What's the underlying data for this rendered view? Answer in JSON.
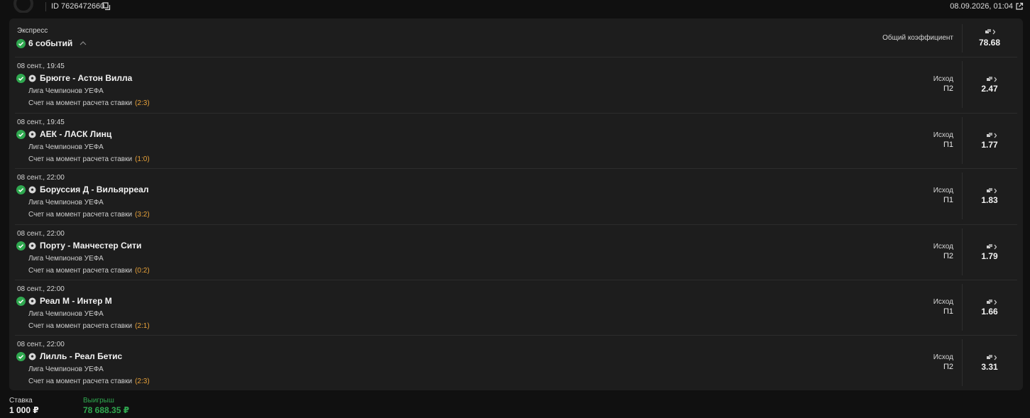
{
  "header": {
    "id_text": "ID 7626472660",
    "datetime": "08.09.2026, 01:04"
  },
  "express": {
    "label": "Экспресс",
    "count": "6 событий",
    "total_label": "Общий коэффициент",
    "total_coef": "78.68"
  },
  "events": [
    {
      "time": "08 сент., 19:45",
      "teams": "Брюгге - Астон Вилла",
      "league": "Лига Чемпионов УЕФА",
      "score_label": "Счет на момент расчета ставки",
      "score": "(2:3)",
      "outcome_label": "Исход",
      "outcome": "П2",
      "coef": "2.47"
    },
    {
      "time": "08 сент., 19:45",
      "teams": "АЕК - ЛАСК Линц",
      "league": "Лига Чемпионов УЕФА",
      "score_label": "Счет на момент расчета ставки",
      "score": "(1:0)",
      "outcome_label": "Исход",
      "outcome": "П1",
      "coef": "1.77"
    },
    {
      "time": "08 сент., 22:00",
      "teams": "Боруссия Д - Вильярреал",
      "league": "Лига Чемпионов УЕФА",
      "score_label": "Счет на момент расчета ставки",
      "score": "(3:2)",
      "outcome_label": "Исход",
      "outcome": "П1",
      "coef": "1.83"
    },
    {
      "time": "08 сент., 22:00",
      "teams": "Порту - Манчестер Сити",
      "league": "Лига Чемпионов УЕФА",
      "score_label": "Счет на момент расчета ставки",
      "score": "(0:2)",
      "outcome_label": "Исход",
      "outcome": "П2",
      "coef": "1.79"
    },
    {
      "time": "08 сент., 22:00",
      "teams": "Реал М - Интер М",
      "league": "Лига Чемпионов УЕФА",
      "score_label": "Счет на момент расчета ставки",
      "score": "(2:1)",
      "outcome_label": "Исход",
      "outcome": "П1",
      "coef": "1.66"
    },
    {
      "time": "08 сент., 22:00",
      "teams": "Лилль - Реал Бетис",
      "league": "Лига Чемпионов УЕФА",
      "score_label": "Счет на момент расчета ставки",
      "score": "(2:3)",
      "outcome_label": "Исход",
      "outcome": "П2",
      "coef": "3.31"
    }
  ],
  "footer": {
    "stake_label": "Ставка",
    "stake_value": "1 000 ₽",
    "win_label": "Выигрыш",
    "win_value": "78 688.35 ₽"
  },
  "colors": {
    "background": "#101010",
    "card": "#1d1d1d",
    "accent_green": "#2fa84f",
    "score_orange": "#e8a23a"
  },
  "icons": [
    "logo-icon",
    "copy-icon",
    "external-link-icon",
    "check-circle-icon",
    "chevron-up-icon",
    "soccer-ball-icon",
    "coefficient-icon"
  ]
}
